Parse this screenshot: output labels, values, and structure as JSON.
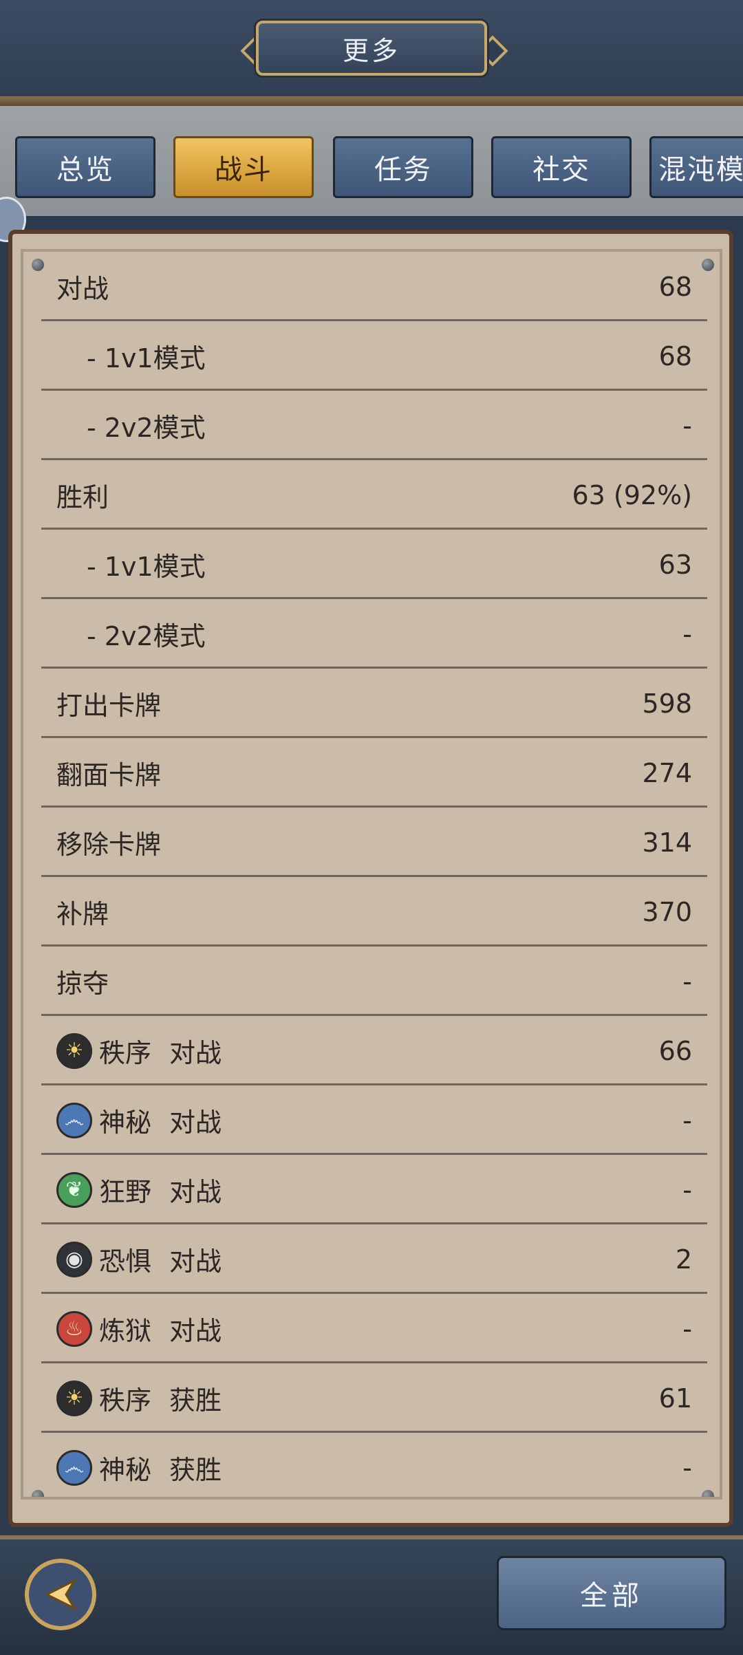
{
  "header": {
    "title": "更多"
  },
  "tabs": [
    {
      "label": "总览",
      "active": false
    },
    {
      "label": "战斗",
      "active": true
    },
    {
      "label": "任务",
      "active": false
    },
    {
      "label": "社交",
      "active": false
    },
    {
      "label": "混沌模",
      "active": false
    }
  ],
  "stats": [
    {
      "label": "对战",
      "value": "68"
    },
    {
      "label": "- 1v1模式",
      "value": "68"
    },
    {
      "label": "- 2v2模式",
      "value": "-"
    },
    {
      "label": "胜利",
      "value": "63 (92%)"
    },
    {
      "label": "- 1v1模式",
      "value": "63"
    },
    {
      "label": "- 2v2模式",
      "value": "-"
    },
    {
      "label": "打出卡牌",
      "value": "598"
    },
    {
      "label": "翻面卡牌",
      "value": "274"
    },
    {
      "label": "移除卡牌",
      "value": "314"
    },
    {
      "label": "补牌",
      "value": "370"
    },
    {
      "label": "掠夺",
      "value": "-"
    }
  ],
  "faction_stats": [
    {
      "icon": "order-sun-icon",
      "faction": "秩序",
      "stat": "对战",
      "value": "66"
    },
    {
      "icon": "mystic-swirl-icon",
      "faction": "神秘",
      "stat": "对战",
      "value": "-"
    },
    {
      "icon": "wild-leaf-icon",
      "faction": "狂野",
      "stat": "对战",
      "value": "-"
    },
    {
      "icon": "fear-eye-icon",
      "faction": "恐惧",
      "stat": "对战",
      "value": "2"
    },
    {
      "icon": "hell-flame-icon",
      "faction": "炼狱",
      "stat": "对战",
      "value": "-"
    },
    {
      "icon": "order-sun-icon",
      "faction": "秩序",
      "stat": "获胜",
      "value": "61"
    },
    {
      "icon": "mystic-swirl-icon",
      "faction": "神秘",
      "stat": "获胜",
      "value": "-"
    }
  ],
  "footer": {
    "all_label": "全部"
  }
}
